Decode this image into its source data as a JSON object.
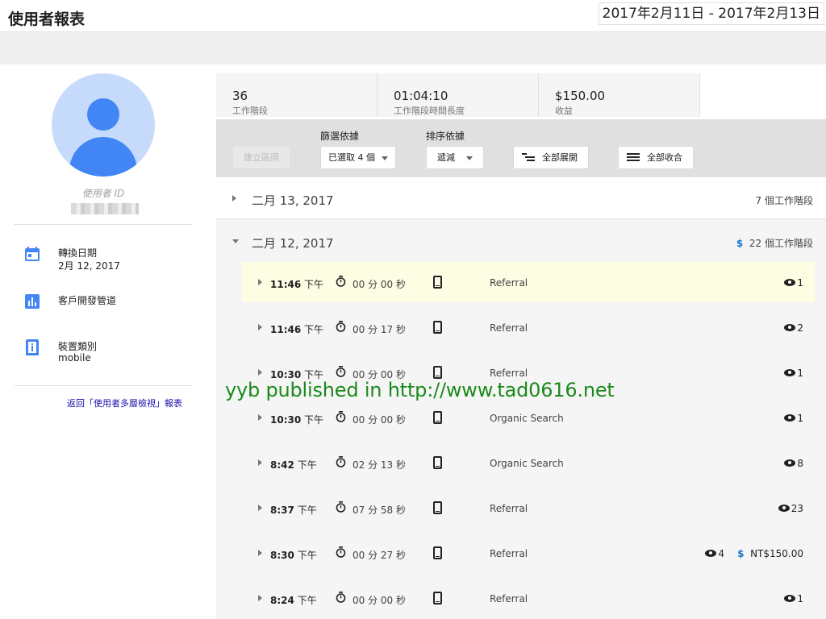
{
  "header": {
    "title": "使用者報表",
    "date_range": "2017年2月11日 - 2017年2月13日"
  },
  "sidebar": {
    "user_id_label": "使用者 ID",
    "acquisition_date": {
      "title": "轉換日期",
      "value": "2月 12, 2017",
      "icon": "calendar-icon"
    },
    "channel": {
      "title": "客戶開發管道",
      "icon": "bar-chart-icon"
    },
    "device": {
      "title": "裝置類別",
      "value": "mobile",
      "icon": "device-info-icon"
    },
    "back_link": "返回「使用者多層檢視」報表"
  },
  "metrics": [
    {
      "value": "36",
      "label": "工作階段"
    },
    {
      "value": "01:04:10",
      "label": "工作階段時間長度"
    },
    {
      "value": "$150.00",
      "label": "收益"
    }
  ],
  "toolbar": {
    "create_segment": "建立區隔",
    "filter_label": "篩選依據",
    "filter_value": "已選取 4 個",
    "sort_label": "排序依據",
    "sort_value": "遞減",
    "expand_all": "全部展開",
    "collapse_all": "全部收合"
  },
  "days": [
    {
      "label": "二月 13, 2017",
      "count": "7 個工作階段",
      "expanded": false
    },
    {
      "label": "二月 12, 2017",
      "count": "22 個工作階段",
      "expanded": true,
      "has_revenue": true,
      "revenue_symbol": "$"
    }
  ],
  "sessions": [
    {
      "time": "11:46",
      "ampm": "下午",
      "duration": "00 分 00 秒",
      "source": "Referral",
      "views": "1",
      "highlighted": true
    },
    {
      "time": "11:46",
      "ampm": "下午",
      "duration": "00 分 17 秒",
      "source": "Referral",
      "views": "2"
    },
    {
      "time": "10:30",
      "ampm": "下午",
      "duration": "00 分 00 秒",
      "source": "Referral",
      "views": "1"
    },
    {
      "time": "10:30",
      "ampm": "下午",
      "duration": "00 分 00 秒",
      "source": "Organic Search",
      "views": "1"
    },
    {
      "time": "8:42",
      "ampm": "下午",
      "duration": "02 分 13 秒",
      "source": "Organic Search",
      "views": "8"
    },
    {
      "time": "8:37",
      "ampm": "下午",
      "duration": "07 分 58 秒",
      "source": "Referral",
      "views": "23"
    },
    {
      "time": "8:30",
      "ampm": "下午",
      "duration": "00 分 27 秒",
      "source": "Referral",
      "views": "4",
      "revenue": "NT$150.00",
      "revenue_symbol": "$"
    },
    {
      "time": "8:24",
      "ampm": "下午",
      "duration": "00 分 00 秒",
      "source": "Referral",
      "views": "1"
    }
  ],
  "watermark": "yyb published in http://www.tad0616.net",
  "colors": {
    "accent": "#4285f4",
    "highlight_row": "#fdfde3",
    "watermark": "#1b8a1b"
  }
}
